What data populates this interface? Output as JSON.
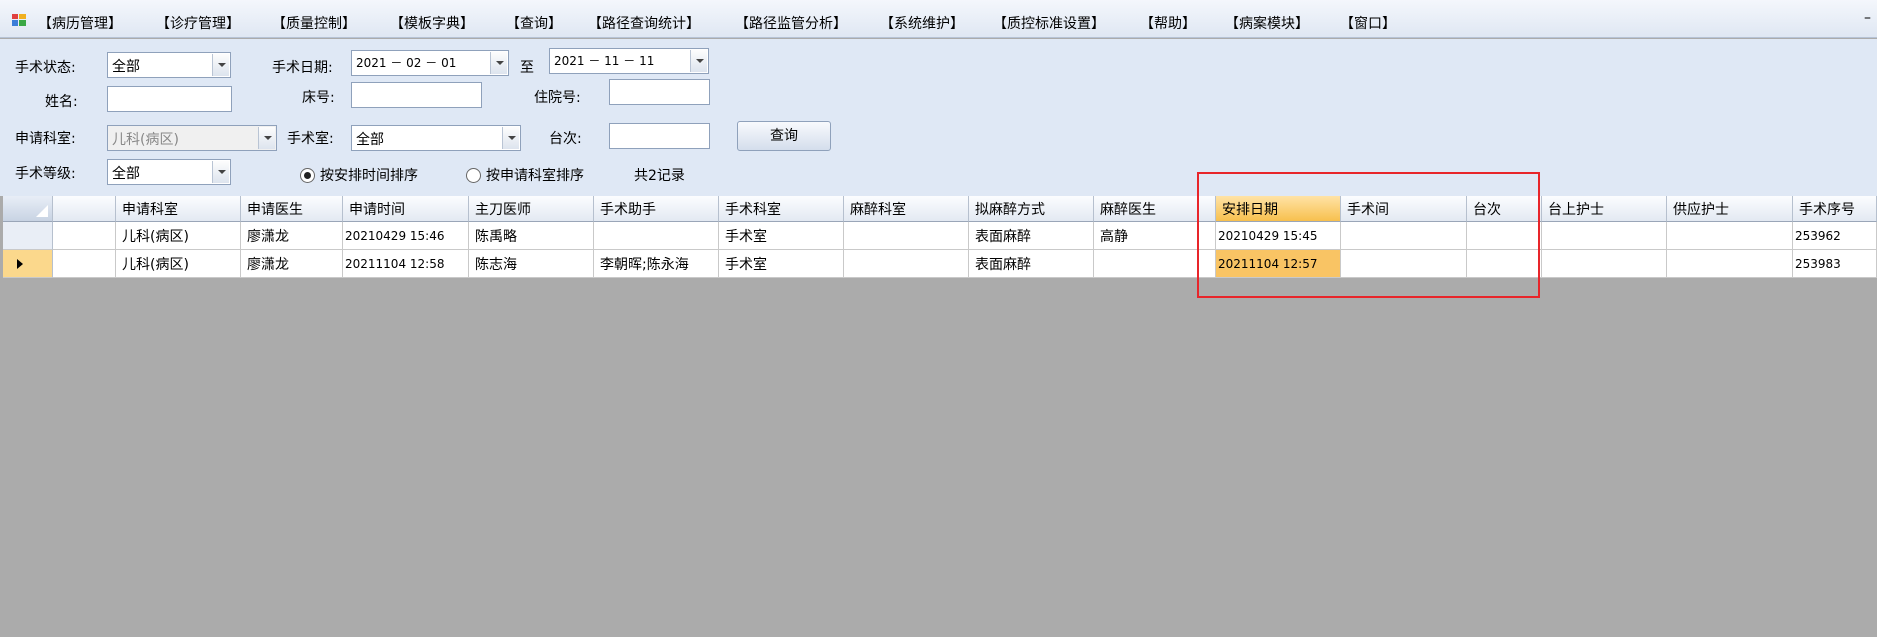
{
  "menu": {
    "items": [
      "【病历管理】",
      "【诊疗管理】",
      "【质量控制】",
      "【模板字典】",
      "【查询】",
      "【路径查询统计】",
      "【路径监管分析】",
      "【系统维护】",
      "【质控标准设置】",
      "【帮助】",
      "【病案模块】",
      "【窗口】"
    ],
    "minimize": "–"
  },
  "filter": {
    "status_label": "手术状态:",
    "status_value": "全部",
    "date_label": "手术日期:",
    "date_from": "2021 － 02 － 01",
    "date_to_label": "至",
    "date_to": "2021 － 11 － 11",
    "name_label": "姓名:",
    "name_value": "",
    "bed_label": "床号:",
    "bed_value": "",
    "admission_label": "住院号:",
    "admission_value": "",
    "dept_label": "申请科室:",
    "dept_value": "儿科(病区)",
    "room_label": "手术室:",
    "room_value": "全部",
    "seq_label": "台次:",
    "seq_value": "",
    "query_button": "查询",
    "level_label": "手术等级:",
    "level_value": "全部",
    "sort_by_schedule": "按安排时间排序",
    "sort_by_dept": "按申请科室排序",
    "record_count": "共2记录"
  },
  "grid": {
    "columns": [
      "",
      "申请科室",
      "申请医生",
      "申请时间",
      "主刀医师",
      "手术助手",
      "手术科室",
      "麻醉科室",
      "拟麻醉方式",
      "麻醉医生",
      "安排日期",
      "手术间",
      "台次",
      "台上护士",
      "供应护士",
      "手术序号"
    ],
    "rows": [
      [
        "",
        "儿科(病区)",
        "廖潇龙",
        "20210429 15:46",
        "陈禹略",
        "",
        "手术室",
        "",
        "表面麻醉",
        "高静",
        "20210429 15:45",
        "",
        "",
        "",
        "",
        "253962"
      ],
      [
        "",
        "儿科(病区)",
        "廖潇龙",
        "20211104 12:58",
        "陈志海",
        "李朝晖;陈永海",
        "手术室",
        "",
        "表面麻醉",
        "",
        "20211104 12:57",
        "",
        "",
        "",
        "",
        "253983"
      ]
    ]
  },
  "colors": {
    "highlight_border": "#e8252a",
    "active_header": "#f7c04e",
    "active_cell": "#f9c464",
    "panel_bg": "#dfe8f5",
    "empty_area": "#ababab"
  }
}
